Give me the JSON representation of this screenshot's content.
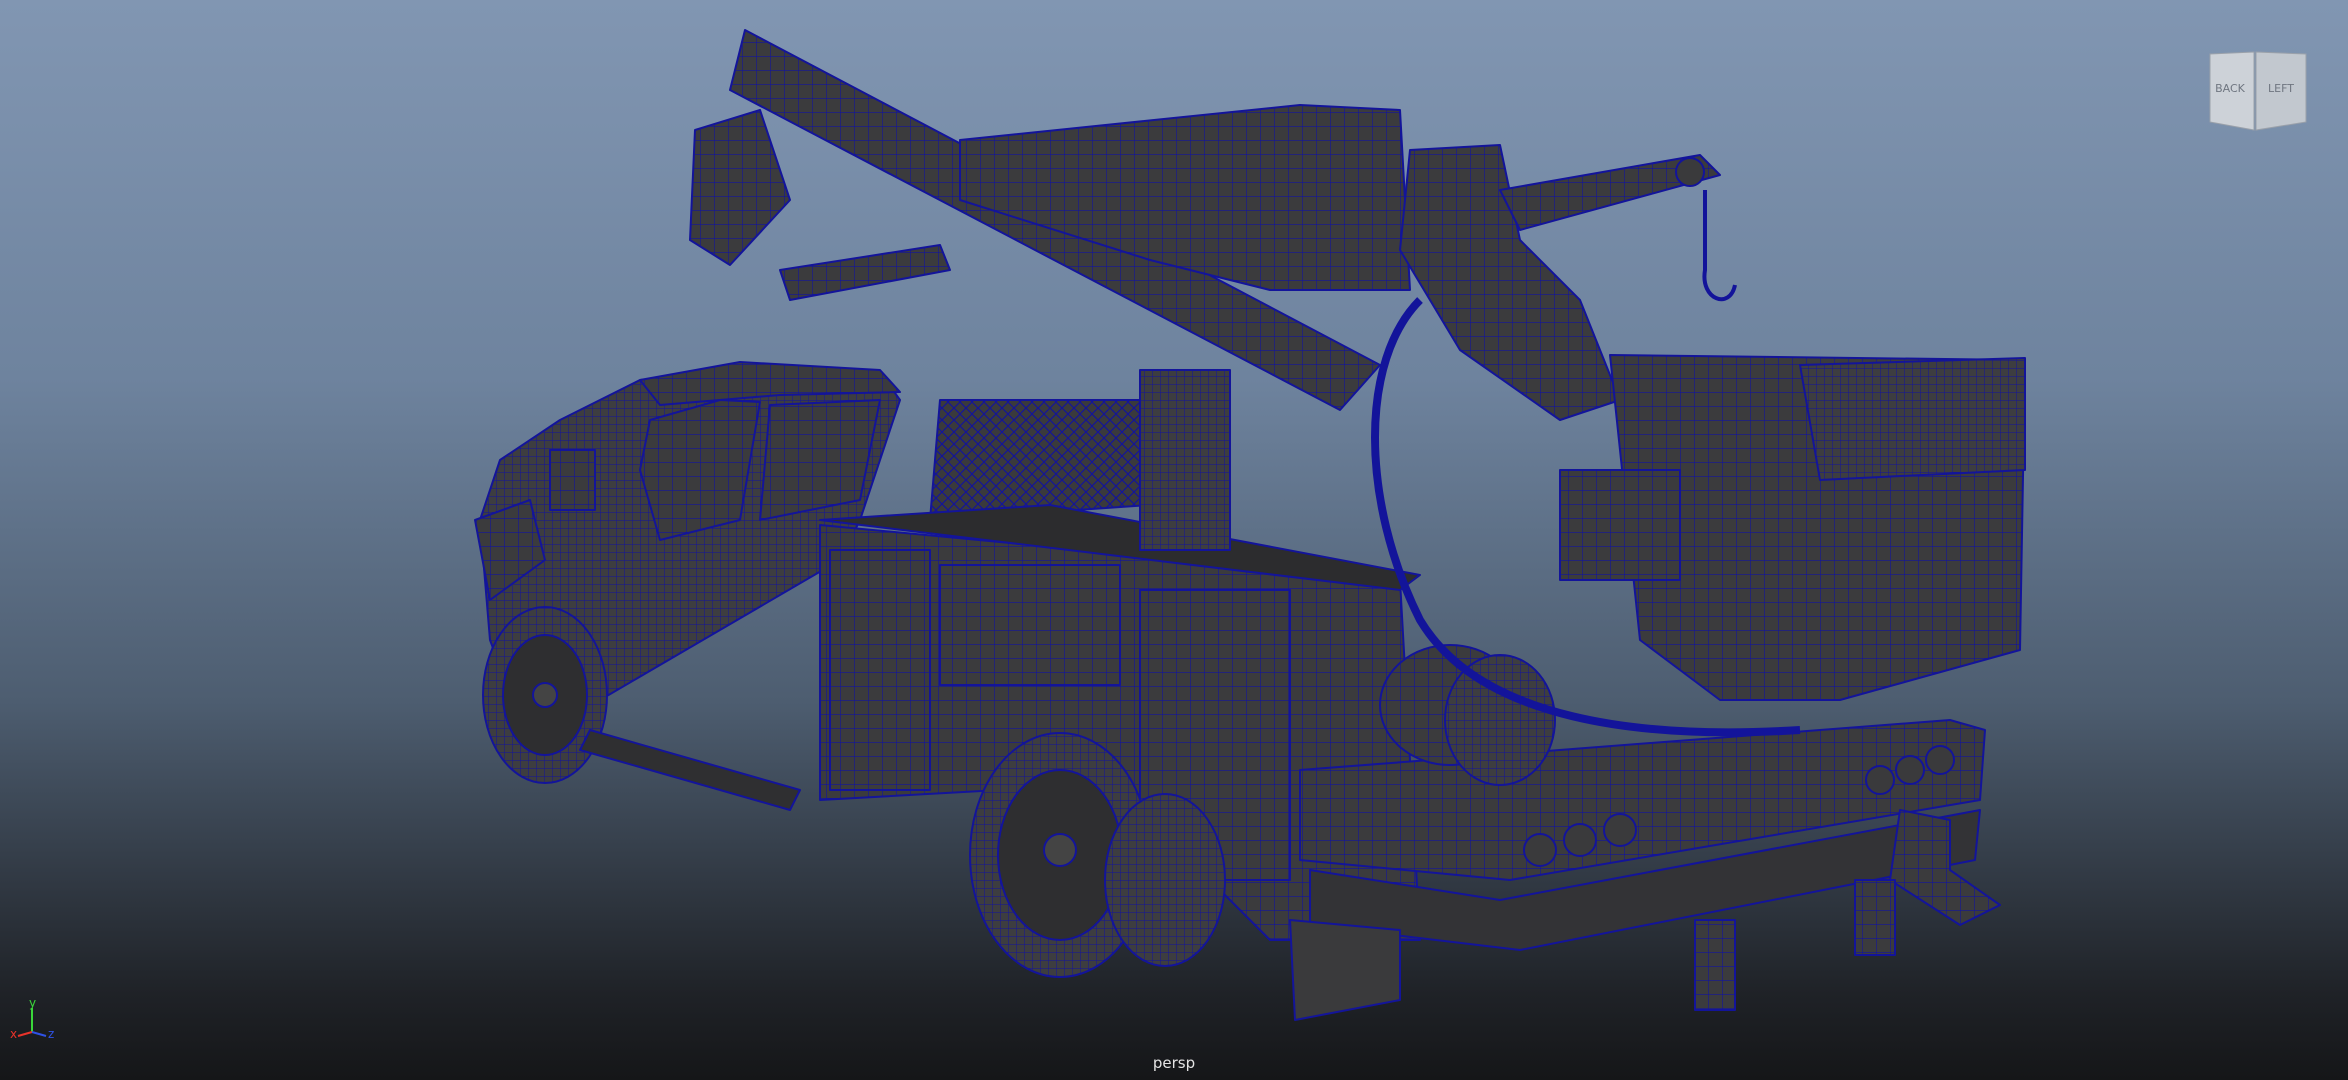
{
  "viewport": {
    "camera_label": "persp",
    "background_top": "#8196b2",
    "background_bottom": "#151618",
    "wireframe_color": "#13149a",
    "model_shade": "#3b3b3d"
  },
  "viewcube": {
    "face_left": "BACK",
    "face_right": "LEFT"
  },
  "axes": {
    "x": "x",
    "y": "y",
    "z": "z",
    "x_color": "#e8332a",
    "y_color": "#3ad63a",
    "z_color": "#2f52e6"
  },
  "scene": {
    "icon": "utility-bucket-truck-model"
  }
}
